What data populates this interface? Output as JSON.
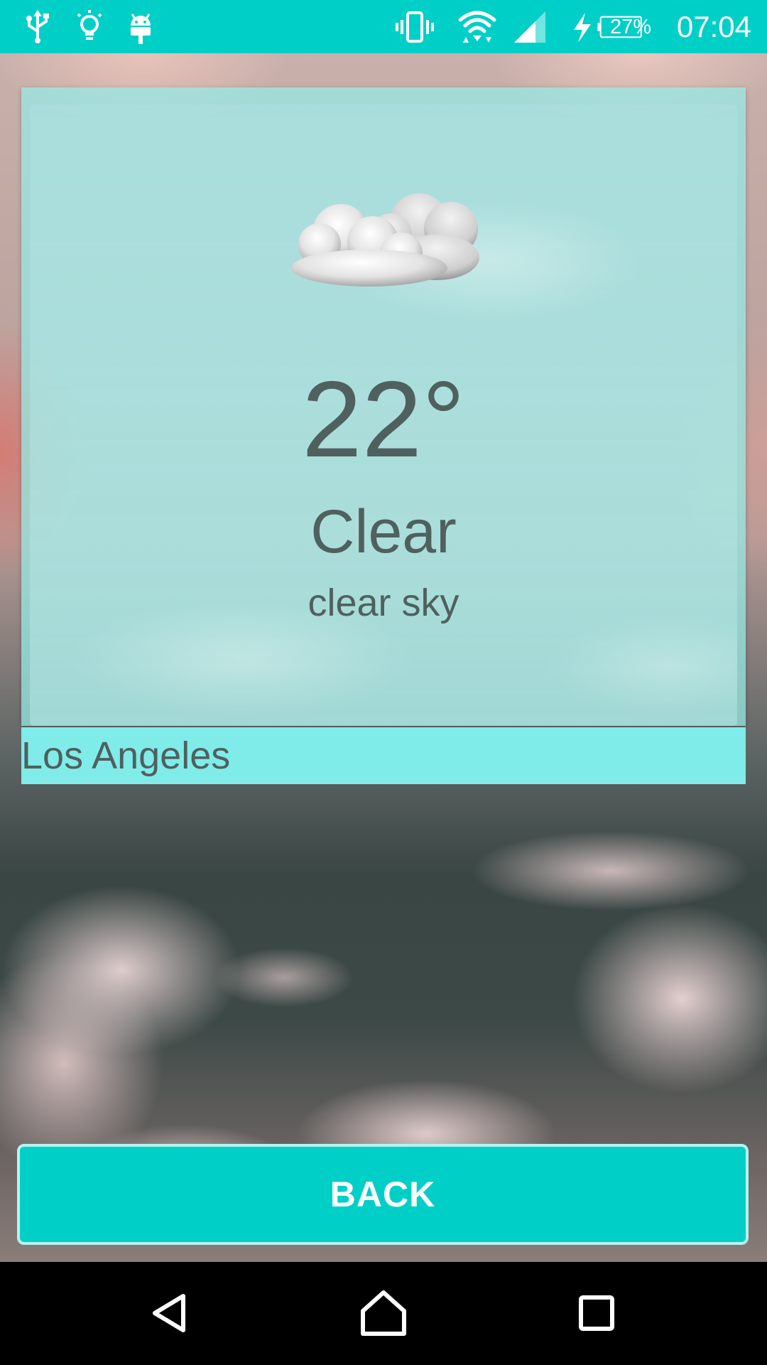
{
  "status_bar": {
    "left_icons": [
      "usb-icon",
      "bulb-icon",
      "android-debug-icon"
    ],
    "right_icons": [
      "vibrate-icon",
      "wifi-icon",
      "cell-signal-icon",
      "charging-icon"
    ],
    "battery_percent": "27%",
    "battery_level": 0.27,
    "time": "07:04"
  },
  "weather": {
    "icon": "cloud-icon",
    "temperature": "22°",
    "condition": "Clear",
    "description": "clear sky"
  },
  "city": {
    "name": "Los Angeles"
  },
  "back_button": {
    "label": "BACK"
  },
  "nav_bar": {
    "icons": [
      "back-triangle-icon",
      "home-icon",
      "recents-icon"
    ]
  },
  "colors": {
    "accent": "#00cfc8",
    "text": "#4f605f",
    "city_bar": "#80ece9"
  }
}
